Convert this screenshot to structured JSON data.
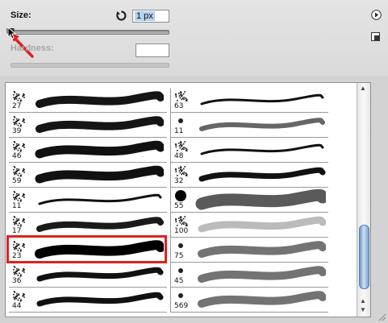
{
  "panel": {
    "size_label": "Size:",
    "size_value": "1 px",
    "hardness_label": "Hardness:",
    "hardness_value": "",
    "size_slider_fraction": 0.0
  },
  "brushes": [
    {
      "left": "27",
      "right": "63"
    },
    {
      "left": "39",
      "right": "11"
    },
    {
      "left": "46",
      "right": "48"
    },
    {
      "left": "59",
      "right": "32"
    },
    {
      "left": "11",
      "right": "55"
    },
    {
      "left": "17",
      "right": "100"
    },
    {
      "left": "23",
      "right": "75"
    },
    {
      "left": "36",
      "right": "45"
    },
    {
      "left": "44",
      "right": "569"
    }
  ],
  "highlighted_brush": "23",
  "colors": {
    "highlight": "#e02020",
    "arrow": "#e02020",
    "selection": "#b4d1f0"
  }
}
